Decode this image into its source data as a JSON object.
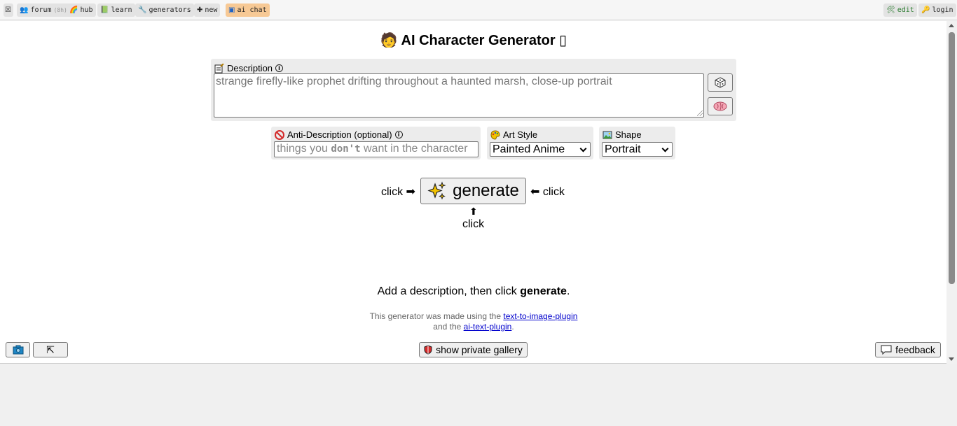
{
  "nav": {
    "left": [
      {
        "icon": "☒",
        "label": ""
      },
      {
        "icon": "👥",
        "label": "forum",
        "extra": "(8h)"
      },
      {
        "icon": "🌈",
        "label": "hub"
      },
      {
        "icon": "📗",
        "label": "learn"
      },
      {
        "icon": "🔧",
        "label": "generators"
      },
      {
        "icon": "✚",
        "label": "new"
      },
      {
        "icon": "▣",
        "label": "ai chat"
      }
    ],
    "right": [
      {
        "icon": "🛠",
        "label": "edit"
      },
      {
        "icon": "🔑",
        "label": "login"
      }
    ]
  },
  "title": {
    "emoji": "🧑",
    "text": "AI Character Generator",
    "trailing": "▯"
  },
  "description": {
    "label": "Description",
    "placeholder": "strange firefly-like prophet drifting throughout a haunted marsh, close-up portrait",
    "buttons": {
      "dice": "⬡",
      "brain": "🧠"
    }
  },
  "anti_description": {
    "label": "Anti-Description (optional)",
    "placeholder_pre": "things you ",
    "placeholder_bold": "don't",
    "placeholder_post": " want in the character"
  },
  "art_style": {
    "label": "Art Style",
    "value": "Painted Anime"
  },
  "shape": {
    "label": "Shape",
    "value": "Portrait"
  },
  "generate": {
    "label": "generate",
    "click_left": "click ➡",
    "click_right": "⬅ click",
    "click_below_arrow": "⬆",
    "click_below": "click"
  },
  "hint": {
    "pre": "Add a description, then click ",
    "bold": "generate",
    "post": "."
  },
  "credit": {
    "line1_pre": "This generator was made using the ",
    "link1": "text-to-image-plugin",
    "line2_pre": "and the ",
    "link2": "ai-text-plugin",
    "line2_post": "."
  },
  "footer": {
    "gallery": "show private gallery",
    "feedback": "feedback",
    "expand": "⇱"
  },
  "colors": {
    "active_nav": "#f7c995",
    "link": "#0000cc",
    "panel": "#ececec"
  }
}
